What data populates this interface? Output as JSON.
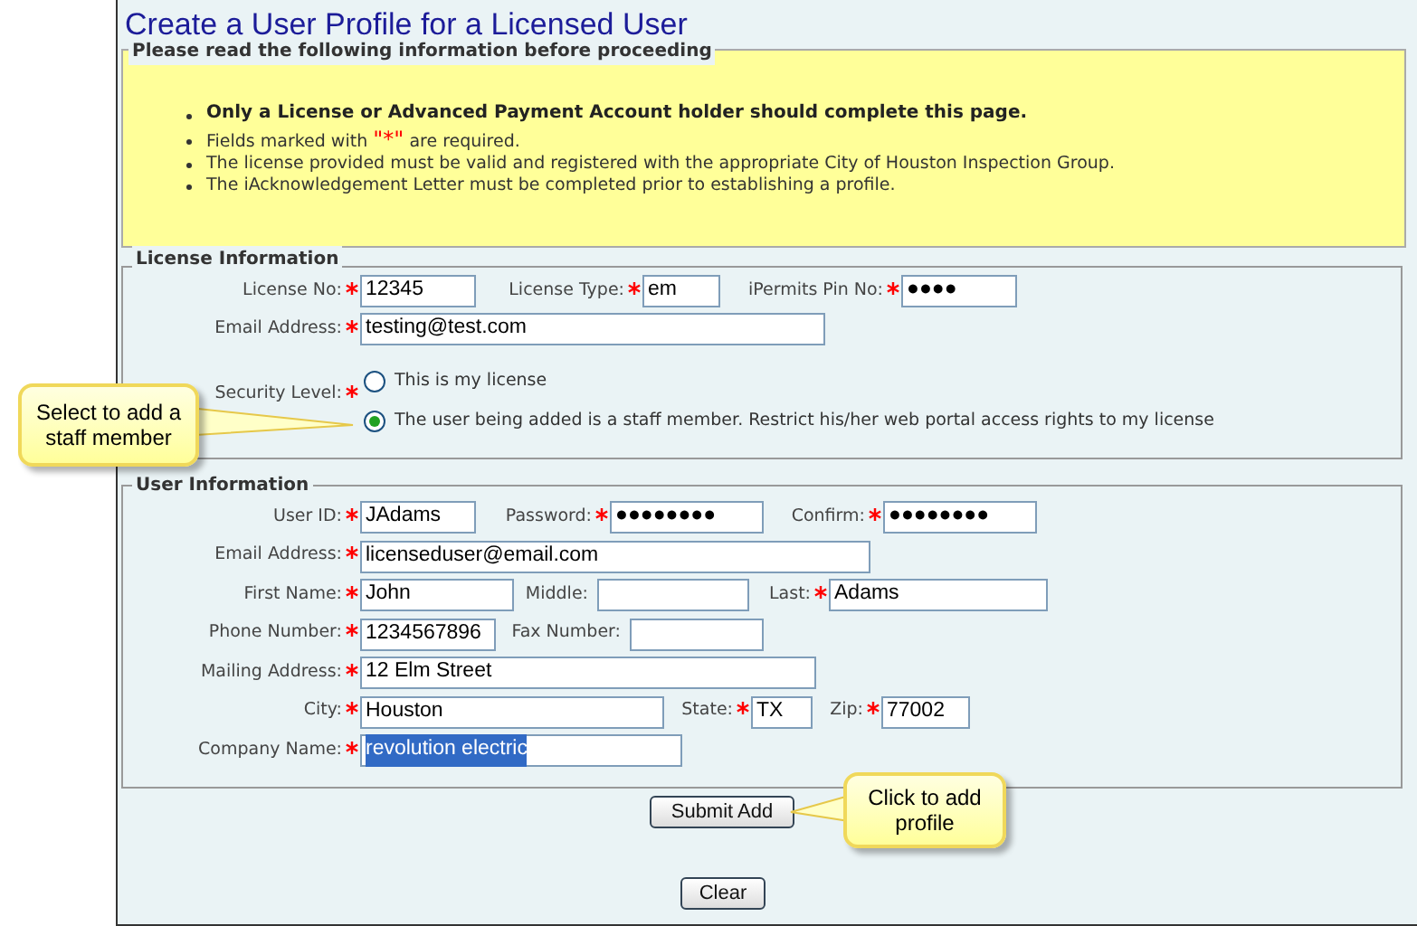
{
  "title": "Create a User Profile for a Licensed User",
  "notice": {
    "legend": "Please read the following information before proceeding",
    "items": [
      "**Only a License or Advanced Payment Account holder should complete this page.**",
      "Fields marked with \"*\" are required.",
      "The license provided must be valid and registered with the appropriate City of Houston Inspection Group.",
      "The iAcknowledgement Letter must be completed prior to establishing a profile."
    ]
  },
  "license": {
    "legend": "License Information",
    "rows": [
      [
        {
          "label": "License No:",
          "required": true,
          "value": "12345"
        },
        {
          "label": "License Type:",
          "required": true,
          "value": "em"
        },
        {
          "label": "iPermits Pin No:",
          "required": true,
          "value": "●●●●"
        }
      ],
      [
        {
          "label": "Email Address:",
          "required": true,
          "value": "testing@test.com"
        }
      ]
    ],
    "security": {
      "label": "Security Level:",
      "required": true,
      "options": [
        {
          "label": "This is my license",
          "selected": false
        },
        {
          "label": "The user being added is a staff member. Restrict his/her web portal access rights to my license",
          "selected": true
        }
      ]
    }
  },
  "user": {
    "legend": "User Information",
    "rows": [
      [
        {
          "label": "User ID:",
          "required": true,
          "value": "JAdams"
        },
        {
          "label": "Password:",
          "required": true,
          "value": "●●●●●●●●"
        },
        {
          "label": "Confirm:",
          "required": true,
          "value": "●●●●●●●●"
        }
      ],
      [
        {
          "label": "Email Address:",
          "required": true,
          "value": "licenseduser@email.com"
        }
      ],
      [
        {
          "label": "First Name:",
          "required": true,
          "value": "John"
        },
        {
          "label": "Middle:",
          "required": false
        },
        {
          "label": "Last:",
          "required": true,
          "value": "Adams"
        }
      ],
      [
        {
          "label": "Phone Number:",
          "required": true,
          "value": "1234567896"
        },
        {
          "label": "Fax Number:",
          "required": false
        }
      ],
      [
        {
          "label": "Mailing Address:",
          "required": true,
          "value": "12 Elm Street"
        }
      ],
      [
        {
          "label": "City:",
          "required": true,
          "value": "Houston"
        },
        {
          "label": "State:",
          "required": true,
          "value": "TX"
        },
        {
          "label": "Zip:",
          "required": true,
          "value": "77002"
        }
      ],
      [
        {
          "label": "Company Name:",
          "required": true,
          "value": "revolution electric",
          "selected": true
        }
      ]
    ]
  },
  "buttons": [
    "Submit Add",
    "Clear"
  ],
  "callouts": [
    "Select to add a staff member",
    "Click to add profile"
  ]
}
